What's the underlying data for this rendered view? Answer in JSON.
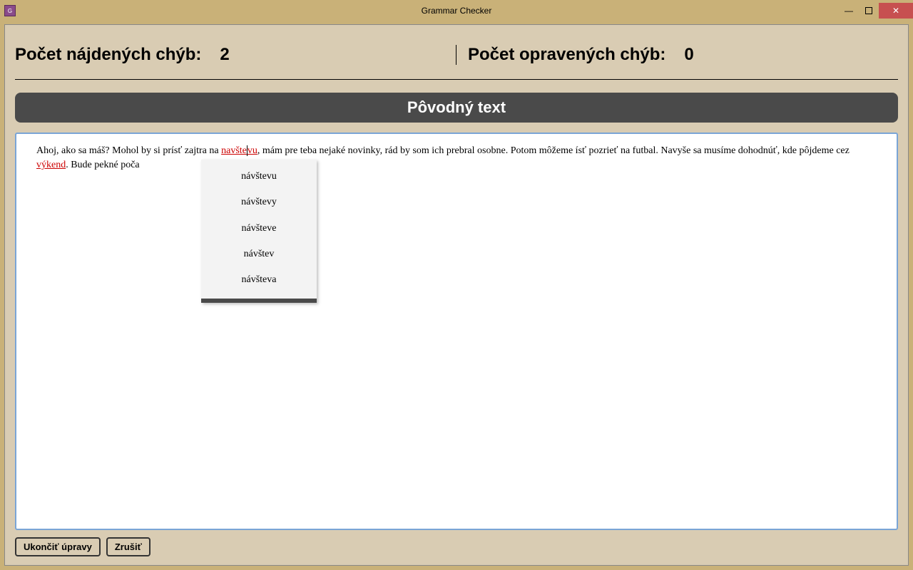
{
  "window": {
    "title": "Grammar Checker",
    "icon_label": "G"
  },
  "counters": {
    "found_label": "Počet nájdených chýb:",
    "found_value": "2",
    "fixed_label": "Počet opravených chýb:",
    "fixed_value": "0"
  },
  "header": {
    "title": "Pôvodný text"
  },
  "text": {
    "part1": "Ahoj, ako sa máš? Mohol by si prísť zajtra na ",
    "error1a": "navšte",
    "error1b": "vu",
    "part2": ", mám pre teba nejaké novinky, rád by som ich prebral osobne. Potom môžeme ísť pozrieť na futbal. Navyše sa musíme dohodnúť, kde pôjdeme cez ",
    "error2": "výkend",
    "part3": ". Bude pekné poča"
  },
  "suggestions": [
    "návštevu",
    "návštevy",
    "návšteve",
    "návštev",
    "návšteva"
  ],
  "buttons": {
    "finish": "Ukončiť úpravy",
    "cancel": "Zrušiť"
  }
}
